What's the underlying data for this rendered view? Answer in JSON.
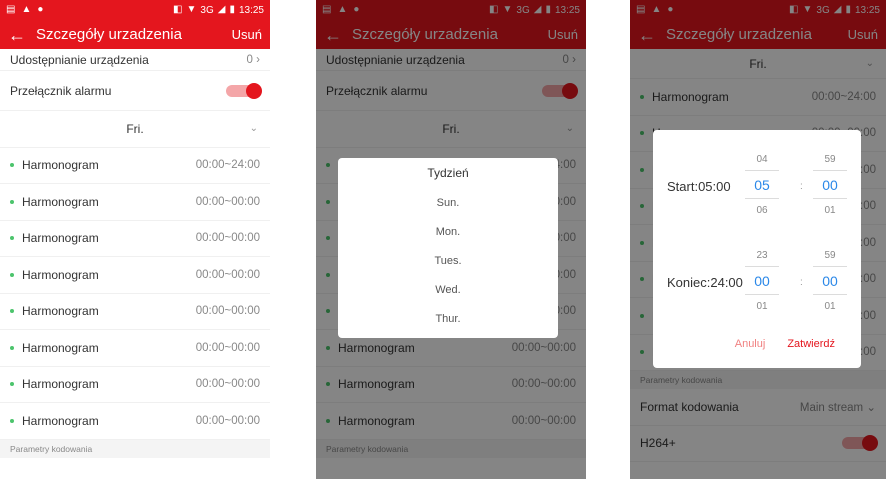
{
  "status_bar": {
    "time": "13:25",
    "network": "3G"
  },
  "header": {
    "back_icon": "arrow-left-icon",
    "title": "Szczegóły urzadzenia",
    "delete_label": "Usuń"
  },
  "settings": {
    "sharing_label": "Udostępnianie urządzenia",
    "sharing_value": "0",
    "alarm_label": "Przełącznik alarmu",
    "alarm_on": true,
    "day": "Fri.",
    "schedules": [
      {
        "label": "Harmonogram",
        "time": "00:00~24:00"
      },
      {
        "label": "Harmonogram",
        "time": "00:00~00:00"
      },
      {
        "label": "Harmonogram",
        "time": "00:00~00:00"
      },
      {
        "label": "Harmonogram",
        "time": "00:00~00:00"
      },
      {
        "label": "Harmonogram",
        "time": "00:00~00:00"
      },
      {
        "label": "Harmonogram",
        "time": "00:00~00:00"
      },
      {
        "label": "Harmonogram",
        "time": "00:00~00:00"
      },
      {
        "label": "Harmonogram",
        "time": "00:00~00:00"
      }
    ],
    "encoding_section": "Parametry kodowania",
    "encoding_format_label": "Format kodowania",
    "encoding_format_value": "Main stream",
    "h264_label": "H264+"
  },
  "week_dialog": {
    "title": "Tydzień",
    "options": [
      "Sun.",
      "Mon.",
      "Tues.",
      "Wed.",
      "Thur."
    ]
  },
  "time_dialog": {
    "start_label": "Start:05:00",
    "start_hour": {
      "prev": "04",
      "current": "05",
      "next": "06"
    },
    "start_minute": {
      "prev": "59",
      "current": "00",
      "next": "01"
    },
    "end_label": "Koniec:24:00",
    "end_hour": {
      "prev": "23",
      "current": "00",
      "next": "01"
    },
    "end_minute": {
      "prev": "59",
      "current": "00",
      "next": "01"
    },
    "colon": ":",
    "cancel_label": "Anuluj",
    "confirm_label": "Zatwierdź"
  },
  "colors": {
    "brand_red": "#e4161e",
    "schedule_dot": "#4cc46c",
    "picker_blue": "#2b88e8"
  }
}
